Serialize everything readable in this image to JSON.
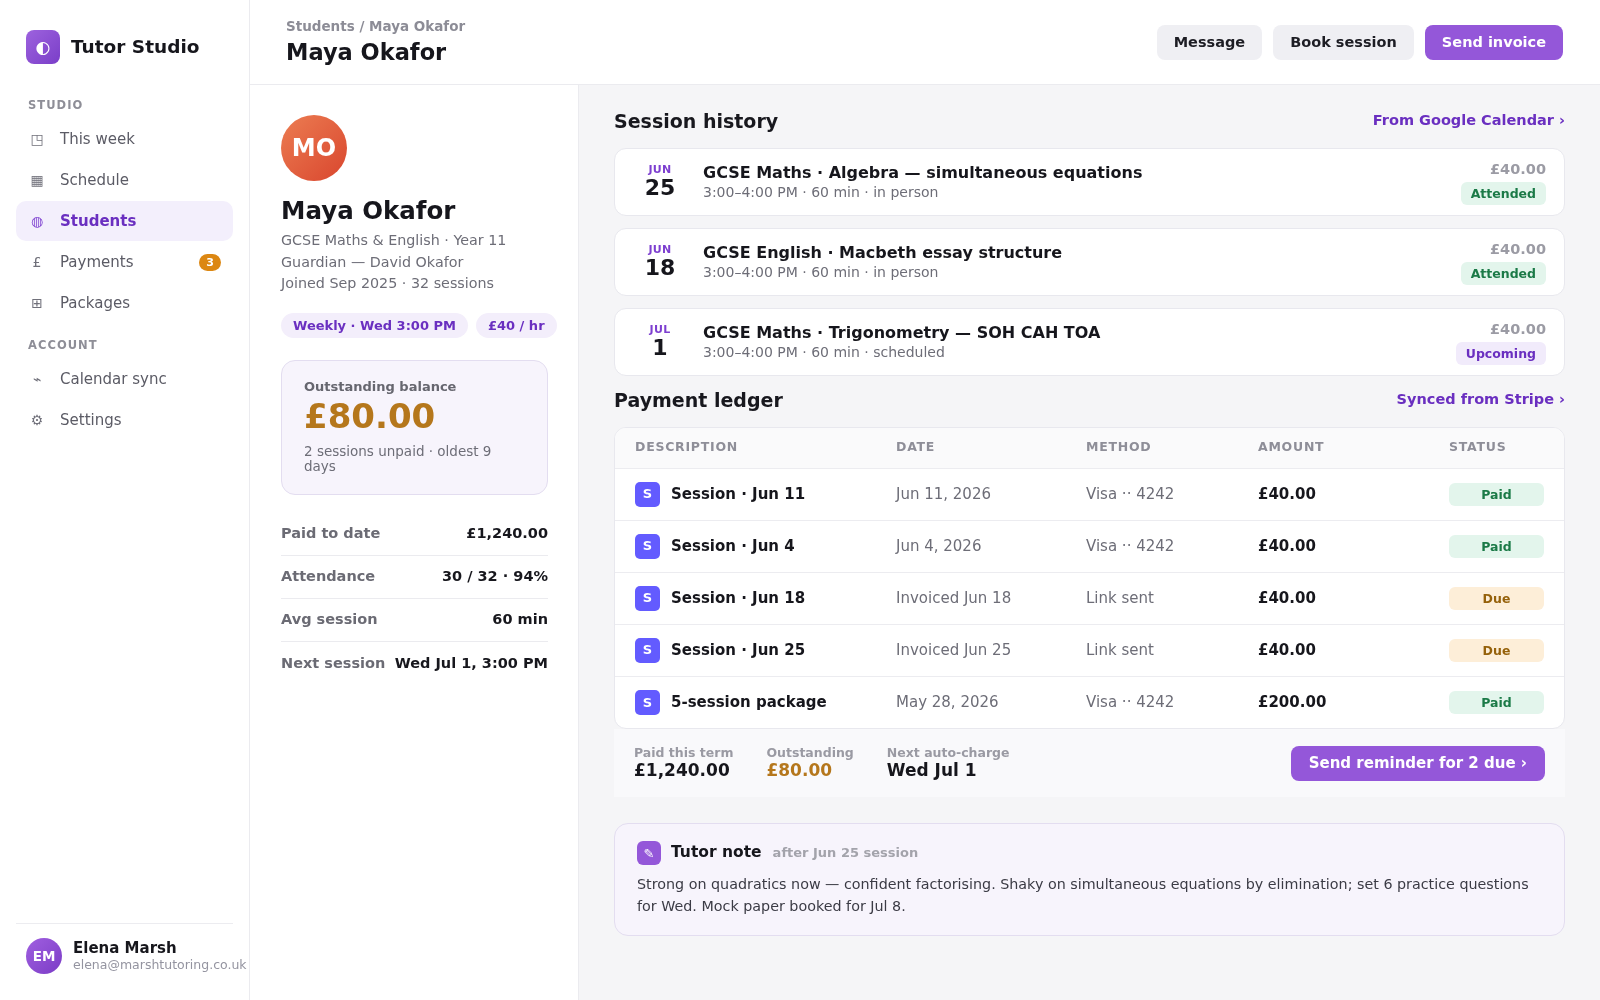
{
  "sidebar": {
    "brand": {
      "logo": "◐",
      "name": "Tutor Studio"
    },
    "sections": [
      {
        "heading": "STUDIO",
        "items": [
          {
            "icon": "◳",
            "label": "This week",
            "selected": false
          },
          {
            "icon": "▦",
            "label": "Schedule",
            "selected": false
          },
          {
            "icon": "◍",
            "label": "Students",
            "selected": true
          },
          {
            "icon": "£",
            "label": "Payments",
            "selected": false,
            "badge": "3"
          },
          {
            "icon": "⊞",
            "label": "Packages",
            "selected": false
          }
        ]
      },
      {
        "heading": "ACCOUNT",
        "items": [
          {
            "icon": "⌁",
            "label": "Calendar sync",
            "selected": false
          },
          {
            "icon": "⚙",
            "label": "Settings",
            "selected": false
          }
        ]
      }
    ],
    "user": {
      "initials": "EM",
      "name": "Elena Marsh",
      "email": "elena@marshtutoring.co.uk"
    }
  },
  "header": {
    "breadcrumb": "Students / Maya Okafor",
    "title": "Maya Okafor",
    "actions": [
      {
        "label": "Message",
        "kind": "secondary"
      },
      {
        "label": "Book session",
        "kind": "secondary"
      },
      {
        "label": "Send invoice",
        "kind": "primary"
      }
    ]
  },
  "profile": {
    "initials": "MO",
    "name": "Maya Okafor",
    "details": [
      "GCSE Maths & English · Year 11",
      "Guardian — David Okafor",
      "Joined Sep 2025 · 32 sessions"
    ],
    "tags": [
      "Weekly · Wed 3:00 PM",
      "£40 / hr"
    ],
    "balance": {
      "label": "Outstanding balance",
      "amount": "£80.00",
      "note": "2 sessions unpaid · oldest 9 days"
    },
    "stats": [
      {
        "label": "Paid to date",
        "value": "£1,240.00"
      },
      {
        "label": "Attendance",
        "value": "30 / 32 · 94%"
      },
      {
        "label": "Avg session",
        "value": "60 min"
      },
      {
        "label": "Next session",
        "value": "Wed Jul 1, 3:00 PM"
      }
    ]
  },
  "session_history": {
    "title": "Session history",
    "link": "From Google Calendar ›",
    "sessions": [
      {
        "month": "JUN",
        "day": "25",
        "title": "GCSE Maths · Algebra — simultaneous equations",
        "meta": "3:00–4:00 PM · 60 min · in person",
        "price": "£40.00",
        "status": "Attended",
        "kind": "attended"
      },
      {
        "month": "JUN",
        "day": "18",
        "title": "GCSE English · Macbeth essay structure",
        "meta": "3:00–4:00 PM · 60 min · in person",
        "price": "£40.00",
        "status": "Attended",
        "kind": "attended"
      },
      {
        "month": "JUL",
        "day": "1",
        "title": "GCSE Maths · Trigonometry — SOH CAH TOA",
        "meta": "3:00–4:00 PM · 60 min · scheduled",
        "price": "£40.00",
        "status": "Upcoming",
        "kind": "upcoming"
      }
    ]
  },
  "payment_ledger": {
    "title": "Payment ledger",
    "link": "Synced from Stripe ›",
    "columns": [
      "DESCRIPTION",
      "DATE",
      "METHOD",
      "AMOUNT",
      "STATUS"
    ],
    "rows": [
      {
        "icon": "S",
        "description": "Session · Jun 11",
        "date": "Jun 11, 2026",
        "method": "Visa ·· 4242",
        "amount": "£40.00",
        "status": "Paid",
        "kind": "paid"
      },
      {
        "icon": "S",
        "description": "Session · Jun 4",
        "date": "Jun 4, 2026",
        "method": "Visa ·· 4242",
        "amount": "£40.00",
        "status": "Paid",
        "kind": "paid"
      },
      {
        "icon": "S",
        "description": "Session · Jun 18",
        "date": "Invoiced Jun 18",
        "method": "Link sent",
        "amount": "£40.00",
        "status": "Due",
        "kind": "due"
      },
      {
        "icon": "S",
        "description": "Session · Jun 25",
        "date": "Invoiced Jun 25",
        "method": "Link sent",
        "amount": "£40.00",
        "status": "Due",
        "kind": "due"
      },
      {
        "icon": "S",
        "description": "5-session package",
        "date": "May 28, 2026",
        "method": "Visa ·· 4242",
        "amount": "£200.00",
        "status": "Paid",
        "kind": "paid"
      }
    ],
    "summary": [
      {
        "label": "Paid this term",
        "value": "£1,240.00",
        "kind": "normal"
      },
      {
        "label": "Outstanding",
        "value": "£80.00",
        "kind": "owed"
      },
      {
        "label": "Next auto-charge",
        "value": "Wed Jul 1",
        "kind": "normal"
      }
    ],
    "action": "Send reminder for 2 due ›"
  },
  "tutor_note": {
    "icon": "✎",
    "title": "Tutor note",
    "subtitle": "after Jun 25 session",
    "text": "Strong on quadratics now — confident factorising. Shaky on simultaneous equations by elimination; set 6 practice questions for Wed. Mock paper booked for Jul 8."
  }
}
